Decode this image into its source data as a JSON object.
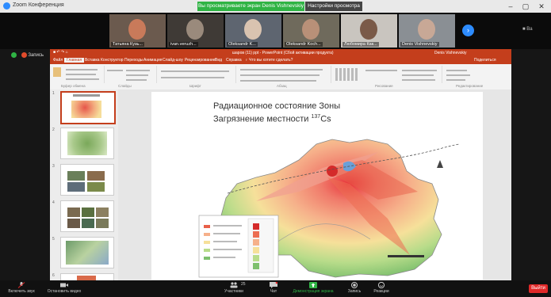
{
  "zoom": {
    "window_title": "Zoom Конференция",
    "share_banner": "Вы просматриваете экран Denis Vishnevskiy",
    "view_options": "Настройки просмотра ⌄",
    "win_minimize": "–",
    "win_maximize": "▢",
    "win_close": "✕",
    "right_panel_label": "■ Ва"
  },
  "participants": [
    {
      "name": "Татьяна Кузь..."
    },
    {
      "name": "ivan.veruzh..."
    },
    {
      "name": "Oleksandr K..."
    },
    {
      "name": "Oleksandr Koch..."
    },
    {
      "name": "Любомира Как..."
    },
    {
      "name": "Denis Vishnevskiy"
    }
  ],
  "recording": {
    "label": "Запись"
  },
  "powerpoint": {
    "title": "шаров (11) ppt - PowerPoint (Сбой активации продукта)",
    "user": "Denis Vishnevskiy",
    "tabs": [
      "Файл",
      "Главная",
      "Вставка",
      "Конструктор",
      "Переходы",
      "Анимация",
      "Слайд-шоу",
      "Рецензирование",
      "Вид",
      "Справка",
      "♀ Что вы хотите сделать?"
    ],
    "share_btn": "Поделиться",
    "ribbon_groups": [
      "Буфер обмена",
      "Слайды",
      "Шрифт",
      "Абзац",
      "Рисование",
      "Редактирование"
    ],
    "thumb_numbers": [
      "1",
      "2",
      "3",
      "4",
      "5",
      "6"
    ]
  },
  "slide": {
    "title_line1": "Радиационное состояние Зоны",
    "title_line2": "Загрязнение местности ",
    "title_sup": "137",
    "title_end": "Cs"
  },
  "toolbar": {
    "mic": "Включить звук",
    "video": "Остановить видео",
    "participants": "Участники",
    "participants_count": "25",
    "chat": "Чат",
    "share": "Демонстрация экрана",
    "record": "Запись",
    "reactions": "Реакции",
    "end": "Выйти"
  },
  "colors": {
    "zoom_blue": "#2d8cff",
    "share_green": "#2fb344",
    "ppt_red": "#c43e1c",
    "end_red": "#e02828"
  }
}
